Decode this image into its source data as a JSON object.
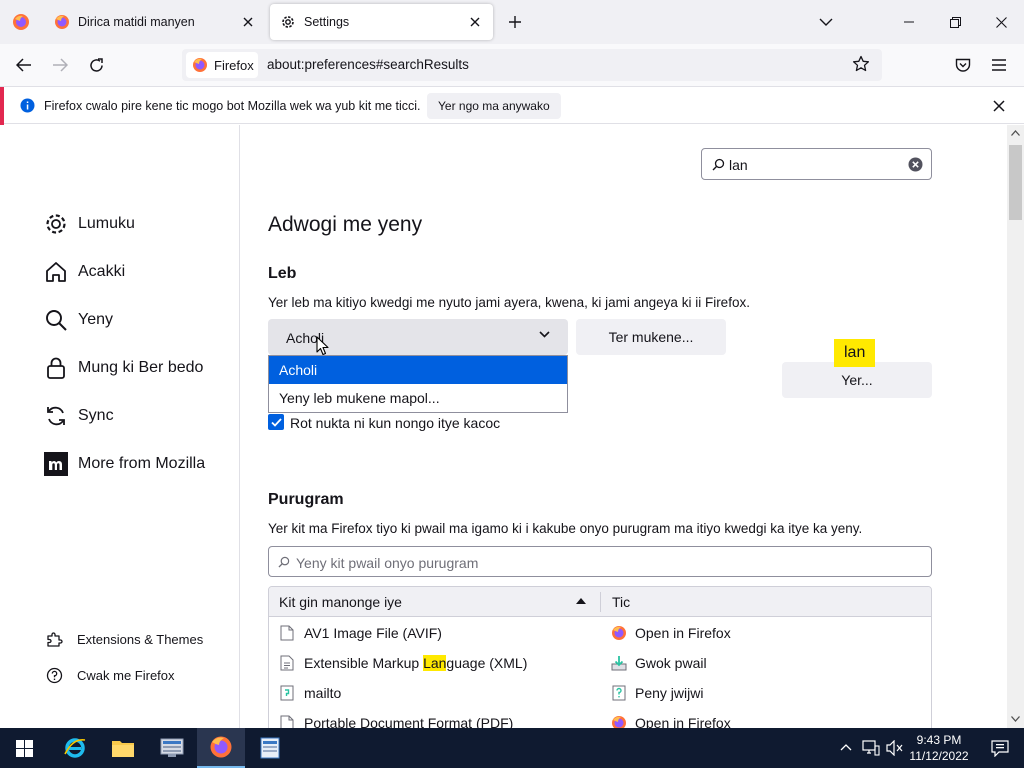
{
  "tabs": [
    {
      "label": "Dirica matidi manyen",
      "icon": "firefox-icon"
    },
    {
      "label": "Settings",
      "icon": "gear-icon"
    }
  ],
  "urlbar": {
    "identity_label": "Firefox",
    "url": "about:preferences#searchResults"
  },
  "notification": {
    "text": "Firefox cwalo pire kene tic mogo bot Mozilla wek wa yub kit me ticci.",
    "button": "Yer ngo ma anywako"
  },
  "sidebar": {
    "categories": [
      {
        "label": "Lumuku",
        "icon": "gear-icon"
      },
      {
        "label": "Acakki",
        "icon": "home-icon"
      },
      {
        "label": "Yeny",
        "icon": "search-icon"
      },
      {
        "label": "Mung ki Ber bedo",
        "icon": "lock-icon"
      },
      {
        "label": "Sync",
        "icon": "sync-icon"
      },
      {
        "label": "More from Mozilla",
        "icon": "mozilla-m-icon"
      }
    ],
    "footer": [
      {
        "label": "Extensions & Themes",
        "icon": "puzzle-icon"
      },
      {
        "label": "Cwak me Firefox",
        "icon": "help-icon"
      }
    ]
  },
  "search": {
    "value": "lan"
  },
  "page": {
    "title": "Adwogi me yeny",
    "language": {
      "heading": "Leb",
      "description": "Yer leb ma kitiyo kwedgi me nyuto jami ayera, kwena, ki jami angeya ki ii Firefox.",
      "selected": "Acholi",
      "alternatives_button": "Ter mukene...",
      "options": [
        "Acholi",
        "Yeny leb mukene mapol..."
      ],
      "tooltip": "lan",
      "choose_button": "Yer...",
      "spellcheck_label": "Rot nukta ni kun nongo itye kacoc",
      "spellcheck_checked": true
    },
    "applications": {
      "heading": "Purugram",
      "description": "Yer kit ma Firefox tiyo ki pwail ma igamo ki i kakube onyo purugram ma itiyo kwedgi ka itye ka yeny.",
      "search_placeholder": "Yeny kit pwail onyo purugram",
      "columns": [
        "Kit gin manonge iye",
        "Tic"
      ],
      "rows": [
        {
          "type": "AV1 Image File (AVIF)",
          "action": "Open in Firefox",
          "action_icon": "firefox-icon"
        },
        {
          "type_before": "Extensible Markup ",
          "type_highlight": "Lan",
          "type_after": "guage (XML)",
          "action": "Gwok pwail",
          "action_icon": "download-icon"
        },
        {
          "type": "mailto",
          "action": "Peny jwijwi",
          "action_icon": "ask-icon"
        },
        {
          "type": "Portable Document Format (PDF)",
          "action": "Open in Firefox",
          "action_icon": "firefox-icon"
        }
      ]
    }
  },
  "taskbar": {
    "clock_time": "9:43 PM",
    "clock_date": "11/12/2022"
  },
  "colors": {
    "accent": "#0060df",
    "highlight": "#ffe900",
    "notification_accent": "#e22850",
    "taskbar": "#0f1a30"
  }
}
